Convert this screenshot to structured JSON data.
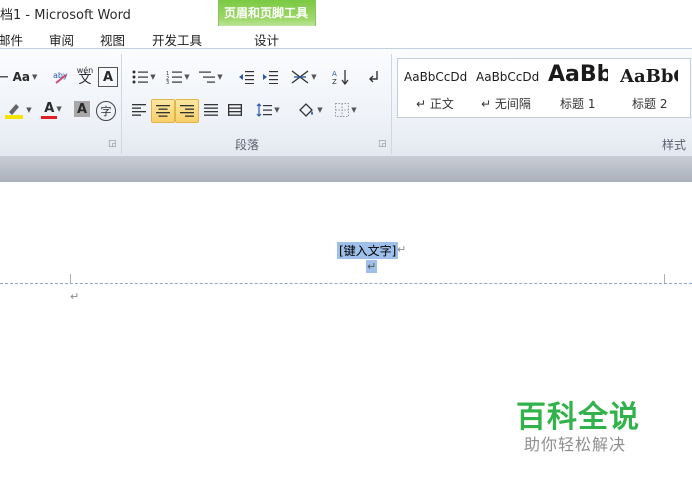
{
  "window": {
    "title": "档1 - Microsoft Word"
  },
  "context_tab_group": {
    "title": "页眉和页脚工具"
  },
  "tabs": [
    {
      "label": "邮件"
    },
    {
      "label": "审阅"
    },
    {
      "label": "视图"
    },
    {
      "label": "开发工具"
    },
    {
      "label": "设计"
    }
  ],
  "font_group": {
    "change_case": "Aa",
    "phonetic_guide": "wén",
    "phonetic_guide_char": "文",
    "char_border": "A",
    "font_color": "A",
    "char_shading": "A",
    "enclose_char": "字"
  },
  "paragraph_group": {
    "label": "段落"
  },
  "styles_group": {
    "label": "样式",
    "items": [
      {
        "sample": "AaBbCcDd",
        "name": "↵ 正文"
      },
      {
        "sample": "AaBbCcDd",
        "name": "↵ 无间隔"
      },
      {
        "sample": "AaBb",
        "name": "标题 1"
      },
      {
        "sample": "AaBbC",
        "name": "标题 2"
      }
    ]
  },
  "document": {
    "header_placeholder": "[键入文字]",
    "paragraph_mark": "↵"
  },
  "watermark": {
    "title": "百科全说",
    "subtitle": "助你轻松解决"
  },
  "colors": {
    "context_green": "#7ac943",
    "selection_blue": "#9ec0ea",
    "watermark_green": "#32b24a",
    "active_button": "#f8d06a"
  }
}
